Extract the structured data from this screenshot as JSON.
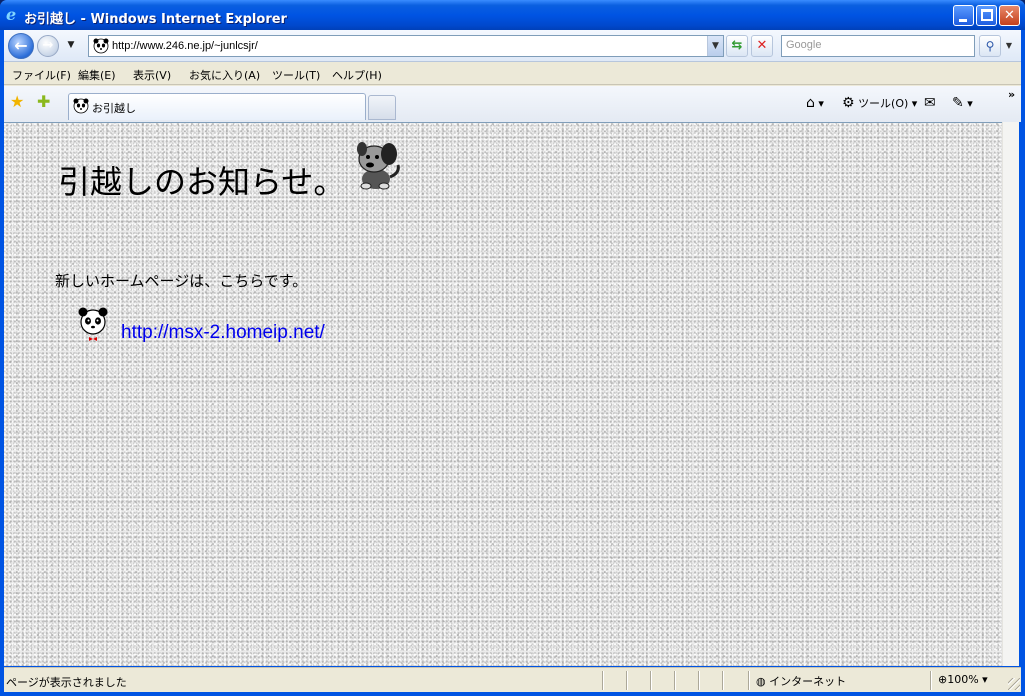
{
  "window": {
    "title": "お引越し - Windows Internet Explorer"
  },
  "addressbar": {
    "url": "http://www.246.ne.jp/~junlcsjr/",
    "search_placeholder": "Google"
  },
  "menu": {
    "items": [
      {
        "label": "ファイル(F)"
      },
      {
        "label": "編集(E)"
      },
      {
        "label": "表示(V)"
      },
      {
        "label": "お気に入り(A)"
      },
      {
        "label": "ツール(T)"
      },
      {
        "label": "ヘルプ(H)"
      }
    ]
  },
  "tabs": {
    "active_label": "お引越し"
  },
  "commandbar": {
    "tools_label": "ツール(O)"
  },
  "page": {
    "heading": "引越しのお知らせ。",
    "notice": "新しいホームページは、こちらです。",
    "link": "http://msx-2.homeip.net/"
  },
  "statusbar": {
    "text": "ページが表示されました",
    "zone": "インターネット",
    "zoom": "100%"
  },
  "colors": {
    "titlebar": "#0054e3",
    "link": "#0000ee",
    "chrome": "#ece9d8"
  }
}
